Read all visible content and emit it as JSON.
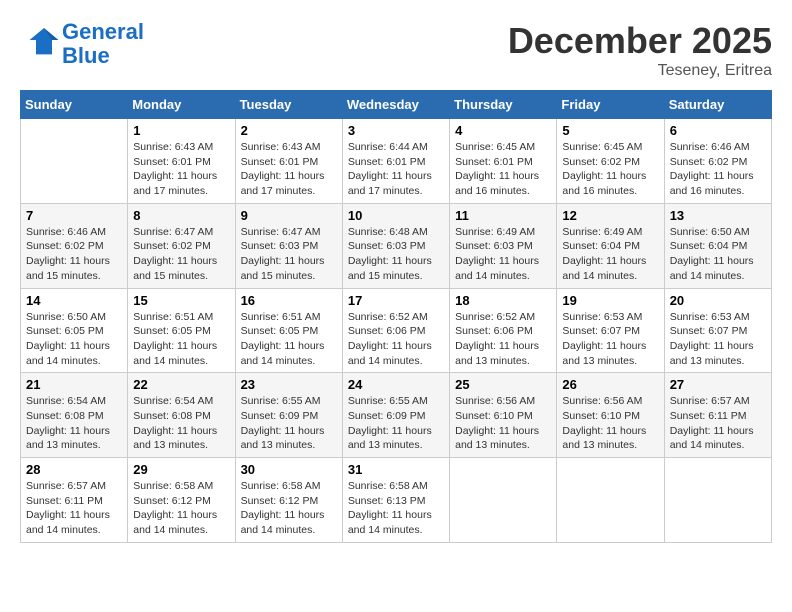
{
  "logo": {
    "line1": "General",
    "line2": "Blue"
  },
  "title": "December 2025",
  "subtitle": "Teseney, Eritrea",
  "days_of_week": [
    "Sunday",
    "Monday",
    "Tuesday",
    "Wednesday",
    "Thursday",
    "Friday",
    "Saturday"
  ],
  "weeks": [
    [
      {
        "num": "",
        "sunrise": "",
        "sunset": "",
        "daylight": ""
      },
      {
        "num": "1",
        "sunrise": "6:43 AM",
        "sunset": "6:01 PM",
        "daylight": "11 hours and 17 minutes."
      },
      {
        "num": "2",
        "sunrise": "6:43 AM",
        "sunset": "6:01 PM",
        "daylight": "11 hours and 17 minutes."
      },
      {
        "num": "3",
        "sunrise": "6:44 AM",
        "sunset": "6:01 PM",
        "daylight": "11 hours and 17 minutes."
      },
      {
        "num": "4",
        "sunrise": "6:45 AM",
        "sunset": "6:01 PM",
        "daylight": "11 hours and 16 minutes."
      },
      {
        "num": "5",
        "sunrise": "6:45 AM",
        "sunset": "6:02 PM",
        "daylight": "11 hours and 16 minutes."
      },
      {
        "num": "6",
        "sunrise": "6:46 AM",
        "sunset": "6:02 PM",
        "daylight": "11 hours and 16 minutes."
      }
    ],
    [
      {
        "num": "7",
        "sunrise": "6:46 AM",
        "sunset": "6:02 PM",
        "daylight": "11 hours and 15 minutes."
      },
      {
        "num": "8",
        "sunrise": "6:47 AM",
        "sunset": "6:02 PM",
        "daylight": "11 hours and 15 minutes."
      },
      {
        "num": "9",
        "sunrise": "6:47 AM",
        "sunset": "6:03 PM",
        "daylight": "11 hours and 15 minutes."
      },
      {
        "num": "10",
        "sunrise": "6:48 AM",
        "sunset": "6:03 PM",
        "daylight": "11 hours and 15 minutes."
      },
      {
        "num": "11",
        "sunrise": "6:49 AM",
        "sunset": "6:03 PM",
        "daylight": "11 hours and 14 minutes."
      },
      {
        "num": "12",
        "sunrise": "6:49 AM",
        "sunset": "6:04 PM",
        "daylight": "11 hours and 14 minutes."
      },
      {
        "num": "13",
        "sunrise": "6:50 AM",
        "sunset": "6:04 PM",
        "daylight": "11 hours and 14 minutes."
      }
    ],
    [
      {
        "num": "14",
        "sunrise": "6:50 AM",
        "sunset": "6:05 PM",
        "daylight": "11 hours and 14 minutes."
      },
      {
        "num": "15",
        "sunrise": "6:51 AM",
        "sunset": "6:05 PM",
        "daylight": "11 hours and 14 minutes."
      },
      {
        "num": "16",
        "sunrise": "6:51 AM",
        "sunset": "6:05 PM",
        "daylight": "11 hours and 14 minutes."
      },
      {
        "num": "17",
        "sunrise": "6:52 AM",
        "sunset": "6:06 PM",
        "daylight": "11 hours and 14 minutes."
      },
      {
        "num": "18",
        "sunrise": "6:52 AM",
        "sunset": "6:06 PM",
        "daylight": "11 hours and 13 minutes."
      },
      {
        "num": "19",
        "sunrise": "6:53 AM",
        "sunset": "6:07 PM",
        "daylight": "11 hours and 13 minutes."
      },
      {
        "num": "20",
        "sunrise": "6:53 AM",
        "sunset": "6:07 PM",
        "daylight": "11 hours and 13 minutes."
      }
    ],
    [
      {
        "num": "21",
        "sunrise": "6:54 AM",
        "sunset": "6:08 PM",
        "daylight": "11 hours and 13 minutes."
      },
      {
        "num": "22",
        "sunrise": "6:54 AM",
        "sunset": "6:08 PM",
        "daylight": "11 hours and 13 minutes."
      },
      {
        "num": "23",
        "sunrise": "6:55 AM",
        "sunset": "6:09 PM",
        "daylight": "11 hours and 13 minutes."
      },
      {
        "num": "24",
        "sunrise": "6:55 AM",
        "sunset": "6:09 PM",
        "daylight": "11 hours and 13 minutes."
      },
      {
        "num": "25",
        "sunrise": "6:56 AM",
        "sunset": "6:10 PM",
        "daylight": "11 hours and 13 minutes."
      },
      {
        "num": "26",
        "sunrise": "6:56 AM",
        "sunset": "6:10 PM",
        "daylight": "11 hours and 13 minutes."
      },
      {
        "num": "27",
        "sunrise": "6:57 AM",
        "sunset": "6:11 PM",
        "daylight": "11 hours and 14 minutes."
      }
    ],
    [
      {
        "num": "28",
        "sunrise": "6:57 AM",
        "sunset": "6:11 PM",
        "daylight": "11 hours and 14 minutes."
      },
      {
        "num": "29",
        "sunrise": "6:58 AM",
        "sunset": "6:12 PM",
        "daylight": "11 hours and 14 minutes."
      },
      {
        "num": "30",
        "sunrise": "6:58 AM",
        "sunset": "6:12 PM",
        "daylight": "11 hours and 14 minutes."
      },
      {
        "num": "31",
        "sunrise": "6:58 AM",
        "sunset": "6:13 PM",
        "daylight": "11 hours and 14 minutes."
      },
      {
        "num": "",
        "sunrise": "",
        "sunset": "",
        "daylight": ""
      },
      {
        "num": "",
        "sunrise": "",
        "sunset": "",
        "daylight": ""
      },
      {
        "num": "",
        "sunrise": "",
        "sunset": "",
        "daylight": ""
      }
    ]
  ]
}
